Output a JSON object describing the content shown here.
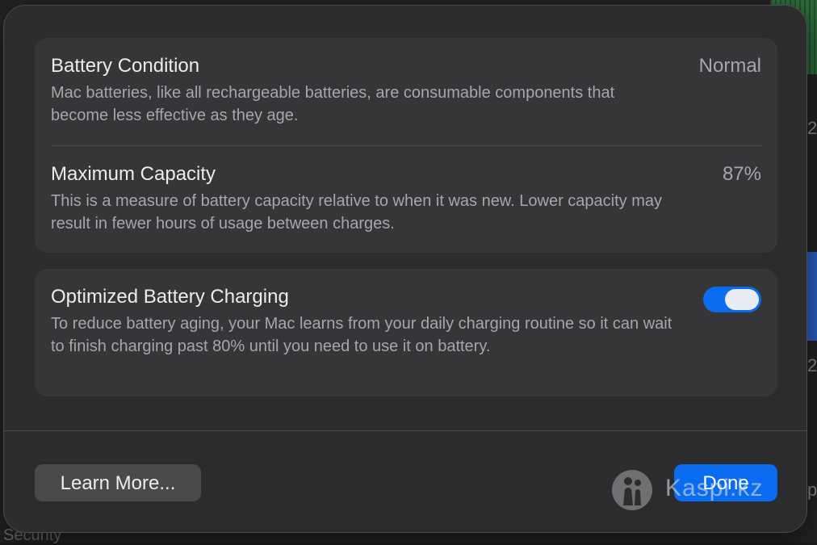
{
  "battery_condition": {
    "title": "Battery Condition",
    "value": "Normal",
    "description": "Mac batteries, like all rechargeable batteries, are consumable components that become less effective as they age."
  },
  "maximum_capacity": {
    "title": "Maximum Capacity",
    "value": "87%",
    "description": "This is a measure of battery capacity relative to when it was new. Lower capacity may result in fewer hours of usage between charges."
  },
  "optimized_charging": {
    "title": "Optimized Battery Charging",
    "enabled": true,
    "description": "To reduce battery aging, your Mac learns from your daily charging routine so it can wait to finish charging past 80% until you need to use it on battery."
  },
  "footer": {
    "learn_more_label": "Learn More...",
    "done_label": "Done"
  },
  "watermark": {
    "text": "Kaspi.kz"
  },
  "background": {
    "peek_text_1": "2",
    "peek_text_2": "2",
    "peek_text_3": "p",
    "security_label": "Security"
  },
  "colors": {
    "accent": "#0a6df0",
    "sheet_bg": "#2c2c2e",
    "group_bg": "#363638"
  }
}
